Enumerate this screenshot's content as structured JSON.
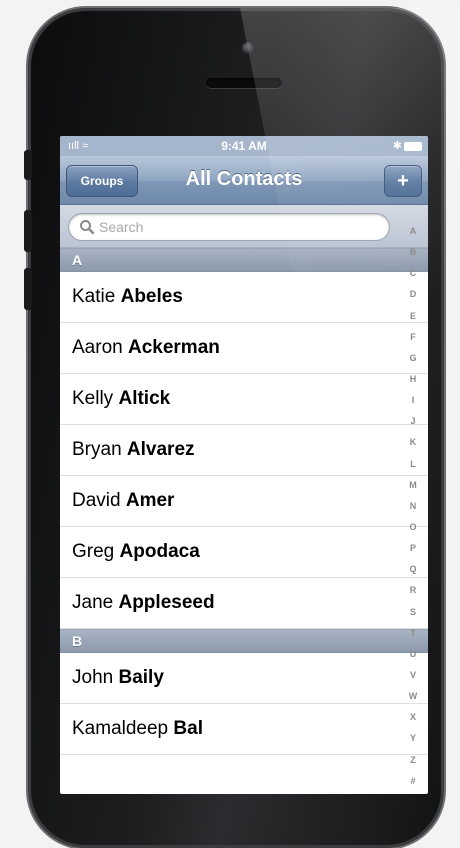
{
  "status_bar": {
    "time": "9:41 AM",
    "signal": "ııll",
    "wifi": "≈",
    "bluetooth": "✱"
  },
  "nav": {
    "title": "All Contacts",
    "left_button": "Groups",
    "right_button": "+"
  },
  "search": {
    "placeholder": "Search"
  },
  "sections": [
    {
      "letter": "A",
      "contacts": [
        {
          "first": "Katie",
          "last": "Abeles"
        },
        {
          "first": "Aaron",
          "last": "Ackerman"
        },
        {
          "first": "Kelly",
          "last": "Altick"
        },
        {
          "first": "Bryan",
          "last": "Alvarez"
        },
        {
          "first": "David",
          "last": "Amer"
        },
        {
          "first": "Greg",
          "last": "Apodaca"
        },
        {
          "first": "Jane",
          "last": "Appleseed"
        }
      ]
    },
    {
      "letter": "B",
      "contacts": [
        {
          "first": "John",
          "last": "Baily"
        },
        {
          "first": "Kamaldeep",
          "last": "Bal"
        }
      ]
    }
  ],
  "index_letters": [
    "A",
    "B",
    "C",
    "D",
    "E",
    "F",
    "G",
    "H",
    "I",
    "J",
    "K",
    "L",
    "M",
    "N",
    "O",
    "P",
    "Q",
    "R",
    "S",
    "T",
    "U",
    "V",
    "W",
    "X",
    "Y",
    "Z",
    "#"
  ]
}
